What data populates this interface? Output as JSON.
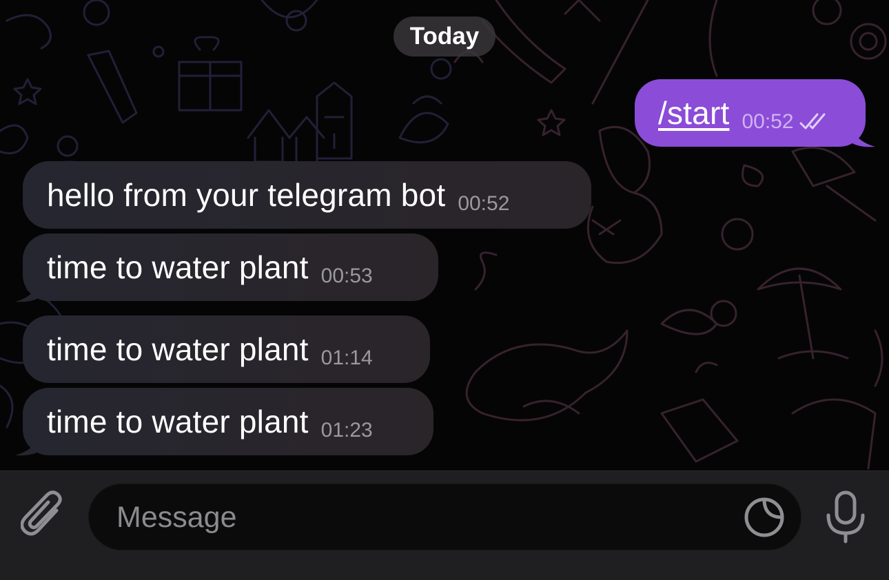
{
  "chat": {
    "date_label": "Today",
    "outgoing": {
      "text": "/start",
      "time": "00:52",
      "status_icon": "double-check-icon"
    },
    "incoming": [
      {
        "text": "hello from your telegram bot",
        "time": "00:52"
      },
      {
        "text": "time to water plant",
        "time": "00:53"
      },
      {
        "text": "time to water plant",
        "time": "01:14"
      },
      {
        "text": "time to water plant",
        "time": "01:23"
      }
    ]
  },
  "input_bar": {
    "placeholder": "Message",
    "attach_icon": "paperclip-icon",
    "sticker_icon": "sticker-icon",
    "mic_icon": "microphone-icon"
  },
  "colors": {
    "outgoing_bubble": "#8b4cd8",
    "incoming_bubble": "#28262c",
    "background": "#000000"
  }
}
